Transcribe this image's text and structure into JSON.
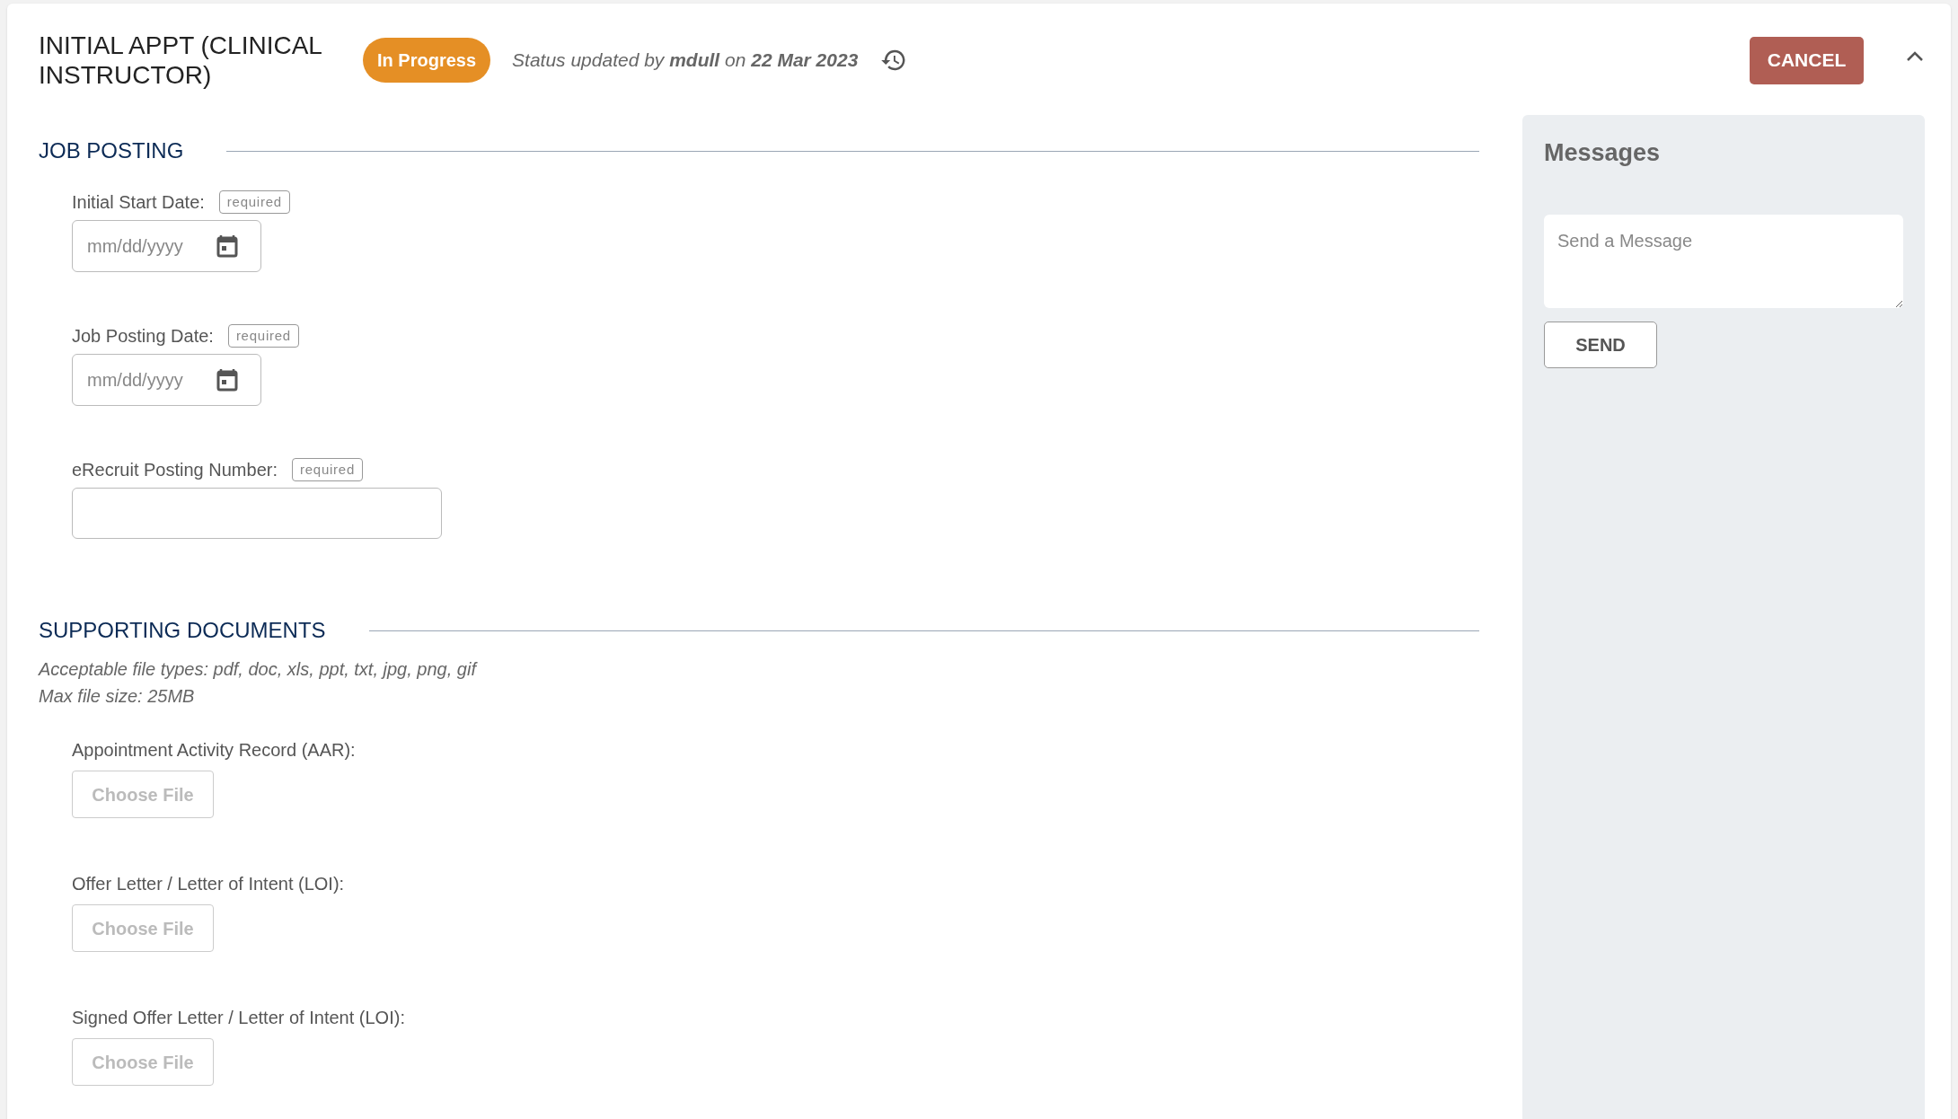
{
  "header": {
    "title": "INITIAL APPT (CLINICAL INSTRUCTOR)",
    "status_badge": "In Progress",
    "status_text": "Status updated by **mdull** on **22 Mar 2023**",
    "cancel_button": "CANCEL"
  },
  "job_posting": {
    "heading": "JOB POSTING",
    "fields": [
      {
        "kind": "date",
        "label": "Initial Start Date:",
        "badge": "required",
        "placeholder": "mm/dd/yyyy"
      },
      {
        "kind": "date",
        "label": "Job Posting Date:",
        "badge": "required",
        "placeholder": "mm/dd/yyyy"
      },
      {
        "kind": "text",
        "label": "eRecruit Posting Number:",
        "badge": "required"
      }
    ]
  },
  "supporting_documents": {
    "heading": "SUPPORTING DOCUMENTS",
    "notes": [
      "Acceptable file types: pdf, doc, xls, ppt, txt, jpg, png, gif",
      "Max file size: 25MB"
    ],
    "files": [
      {
        "label": "Appointment Activity Record (AAR):",
        "button": "Choose File"
      },
      {
        "label": "Offer Letter / Letter of Intent (LOI):",
        "button": "Choose File"
      },
      {
        "label": "Signed Offer Letter / Letter of Intent (LOI):",
        "button": "Choose File"
      }
    ]
  },
  "messages": {
    "title": "Messages",
    "placeholder": "Send a Message",
    "send_button": "SEND"
  }
}
